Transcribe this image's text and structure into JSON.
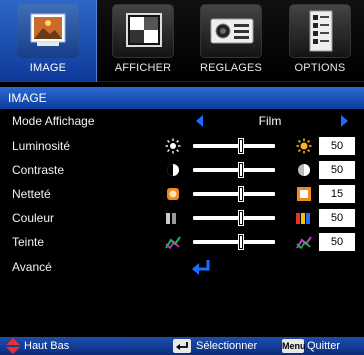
{
  "tabs": [
    {
      "label": "IMAGE",
      "icon": "picture-icon",
      "active": true
    },
    {
      "label": "AFFICHER",
      "icon": "display-icon",
      "active": false
    },
    {
      "label": "REGLAGES",
      "icon": "projector-settings-icon",
      "active": false
    },
    {
      "label": "OPTIONS",
      "icon": "options-checklist-icon",
      "active": false
    }
  ],
  "section_title": "IMAGE",
  "mode": {
    "label": "Mode Affichage",
    "value": "Film"
  },
  "rows": [
    {
      "label": "Luminosité",
      "value": "50",
      "level": 0.58,
      "icon_left": "sun-small-icon",
      "icon_right": "sun-bright-icon"
    },
    {
      "label": "Contraste",
      "value": "50",
      "level": 0.58,
      "icon_left": "contrast-low-icon",
      "icon_right": "contrast-high-icon"
    },
    {
      "label": "Netteté",
      "value": "15",
      "level": 0.58,
      "icon_left": "sharpness-soft-icon",
      "icon_right": "sharpness-sharp-icon"
    },
    {
      "label": "Couleur",
      "value": "50",
      "level": 0.58,
      "icon_left": "color-low-icon",
      "icon_right": "color-high-icon"
    },
    {
      "label": "Teinte",
      "value": "50",
      "level": 0.58,
      "icon_left": "tint-left-icon",
      "icon_right": "tint-right-icon"
    }
  ],
  "advanced": {
    "label": "Avancé",
    "icon": "enter-arrow-icon"
  },
  "footer": {
    "nav_label": "Haut Bas",
    "select_label": "Sélectionner",
    "menu_key": "Menu",
    "quit_label": "Quitter"
  },
  "colors": {
    "accent": "#1a6bff",
    "tab_active": "#2d67c8",
    "footer": "#1d4fb0"
  }
}
